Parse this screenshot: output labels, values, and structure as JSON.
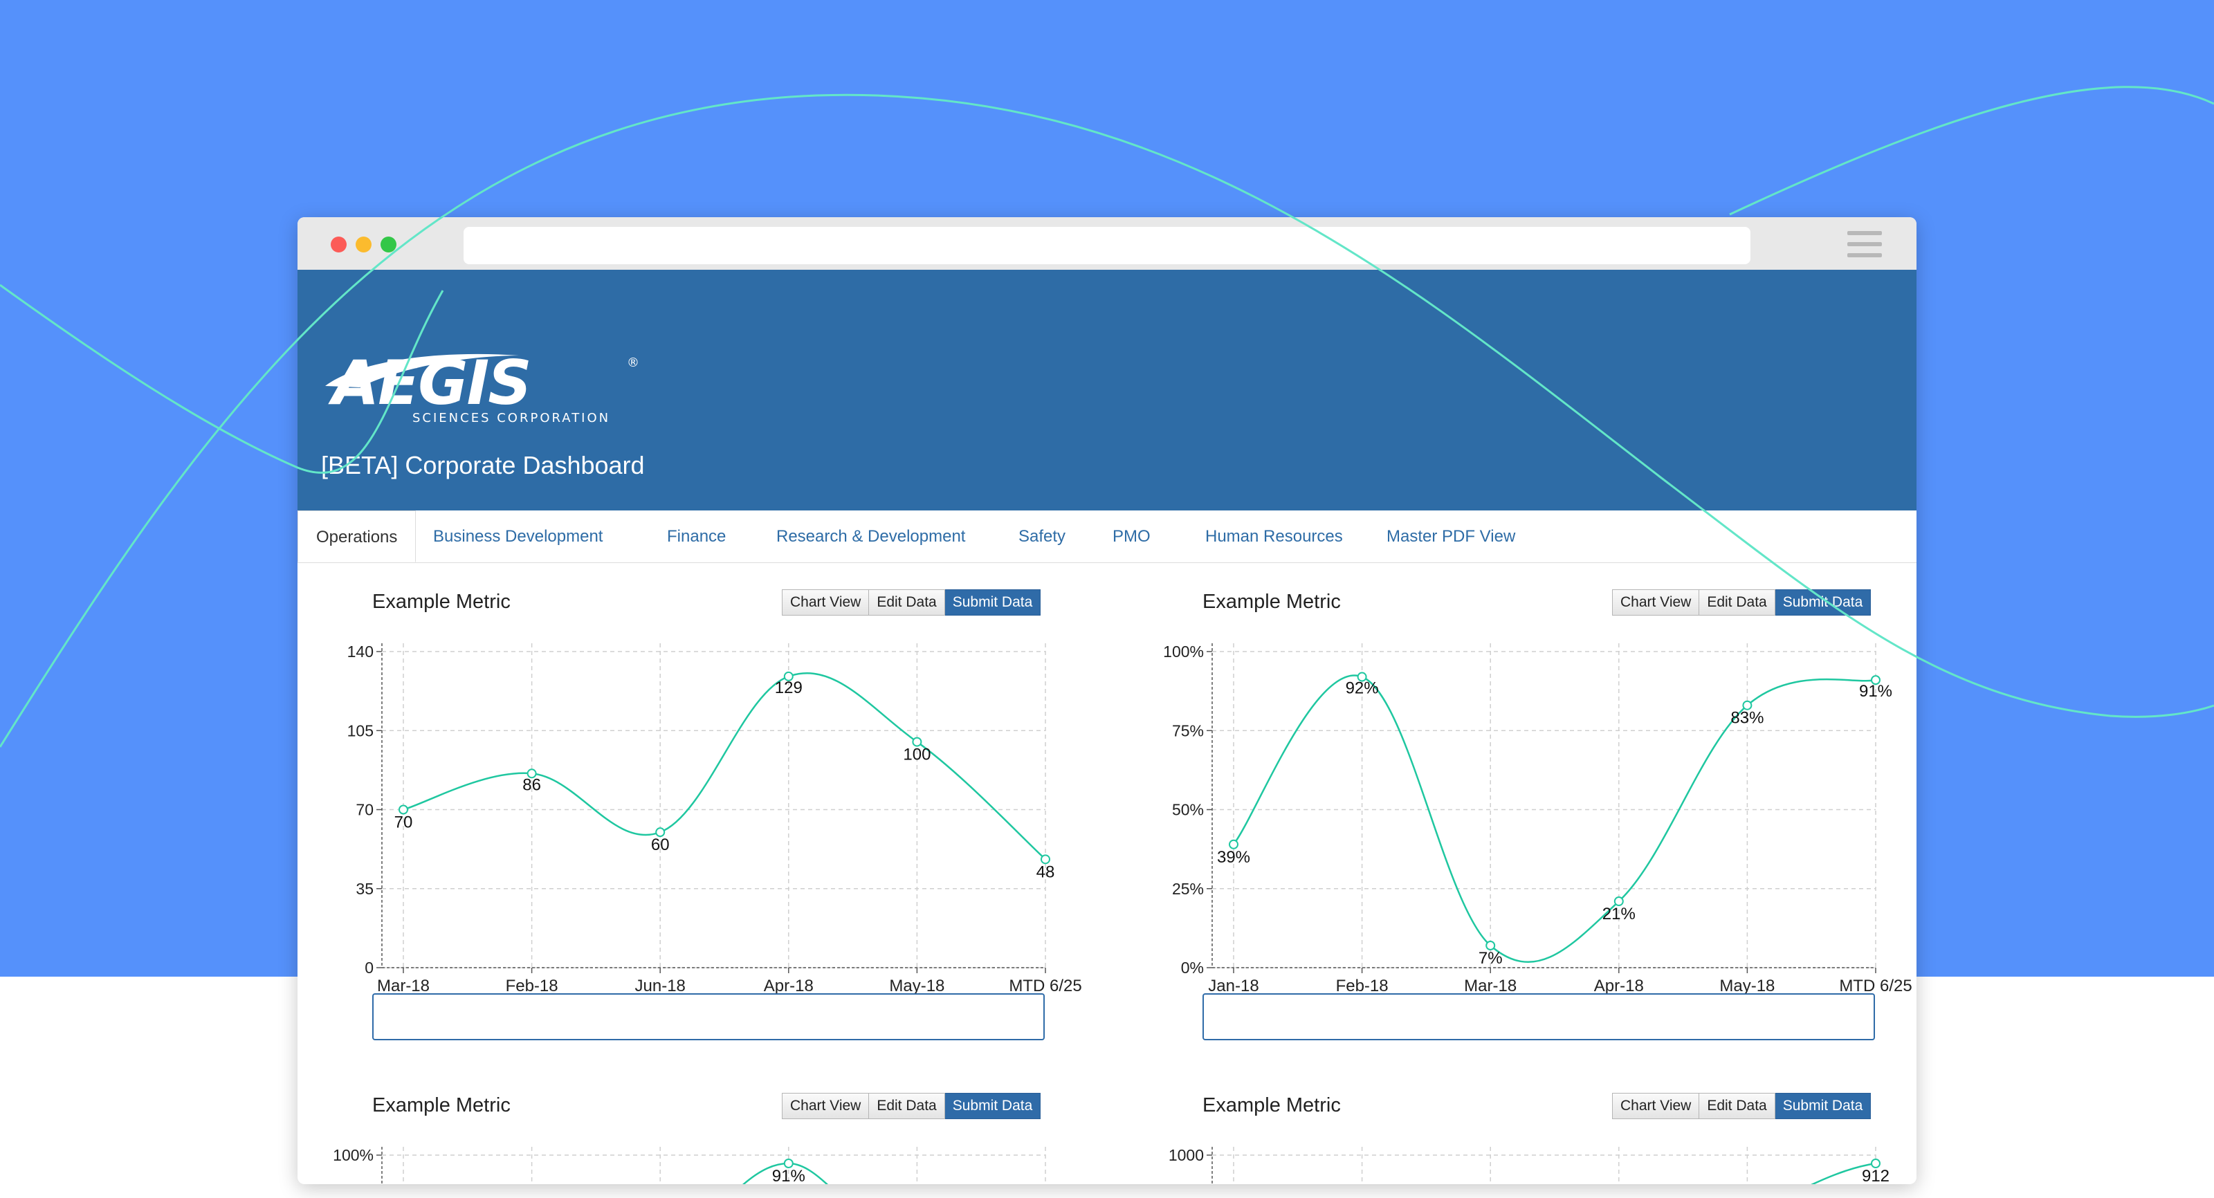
{
  "browser": {
    "url": ""
  },
  "header": {
    "logo_text": "AEGIS",
    "logo_subtext": "SCIENCES CORPORATION",
    "title": "[BETA] Corporate Dashboard"
  },
  "nav": {
    "tabs": [
      {
        "label": "Operations",
        "active": true
      },
      {
        "label": "Business Development"
      },
      {
        "label": "Finance"
      },
      {
        "label": "Research & Development"
      },
      {
        "label": "Safety"
      },
      {
        "label": "PMO"
      },
      {
        "label": "Human Resources"
      },
      {
        "label": "Master PDF View"
      }
    ]
  },
  "panels": [
    {
      "title": "Example Metric",
      "buttons": [
        "Chart View",
        "Edit Data",
        "Submit Data"
      ],
      "comment": ""
    },
    {
      "title": "Example Metric",
      "buttons": [
        "Chart View",
        "Edit Data",
        "Submit Data"
      ],
      "comment": ""
    },
    {
      "title": "Example Metric",
      "buttons": [
        "Chart View",
        "Edit Data",
        "Submit Data"
      ]
    },
    {
      "title": "Example Metric",
      "buttons": [
        "Chart View",
        "Edit Data",
        "Submit Data"
      ]
    }
  ],
  "colors": {
    "accent": "#2f6ba8",
    "header": "#2e6ca6",
    "background": "#5591fb",
    "line": "#1fc7a0"
  },
  "chart_data": [
    {
      "type": "line",
      "categories": [
        "Mar-18",
        "Feb-18",
        "Jun-18",
        "Apr-18",
        "May-18",
        "MTD 6/25"
      ],
      "values": [
        70,
        86,
        60,
        129,
        100,
        48
      ],
      "labels": [
        "70",
        "86",
        "60",
        "129",
        "100",
        "48"
      ],
      "yticks": [
        "0",
        "35",
        "70",
        "105",
        "140"
      ],
      "ylim": [
        0,
        140
      ],
      "grid": true
    },
    {
      "type": "line",
      "categories": [
        "Jan-18",
        "Feb-18",
        "Mar-18",
        "Apr-18",
        "May-18",
        "MTD 6/25"
      ],
      "values": [
        39,
        92,
        7,
        21,
        83,
        91
      ],
      "labels": [
        "39%",
        "92%",
        "7%",
        "21%",
        "83%",
        "91%"
      ],
      "yticks": [
        "0%",
        "25%",
        "50%",
        "75%",
        "100%"
      ],
      "ylim": [
        0,
        100
      ],
      "grid": true
    },
    {
      "type": "line",
      "top_tick": "100%",
      "partial_label": "91%",
      "grid": true
    },
    {
      "type": "line",
      "top_tick": "1000",
      "partial_label": "912",
      "grid": true
    }
  ]
}
